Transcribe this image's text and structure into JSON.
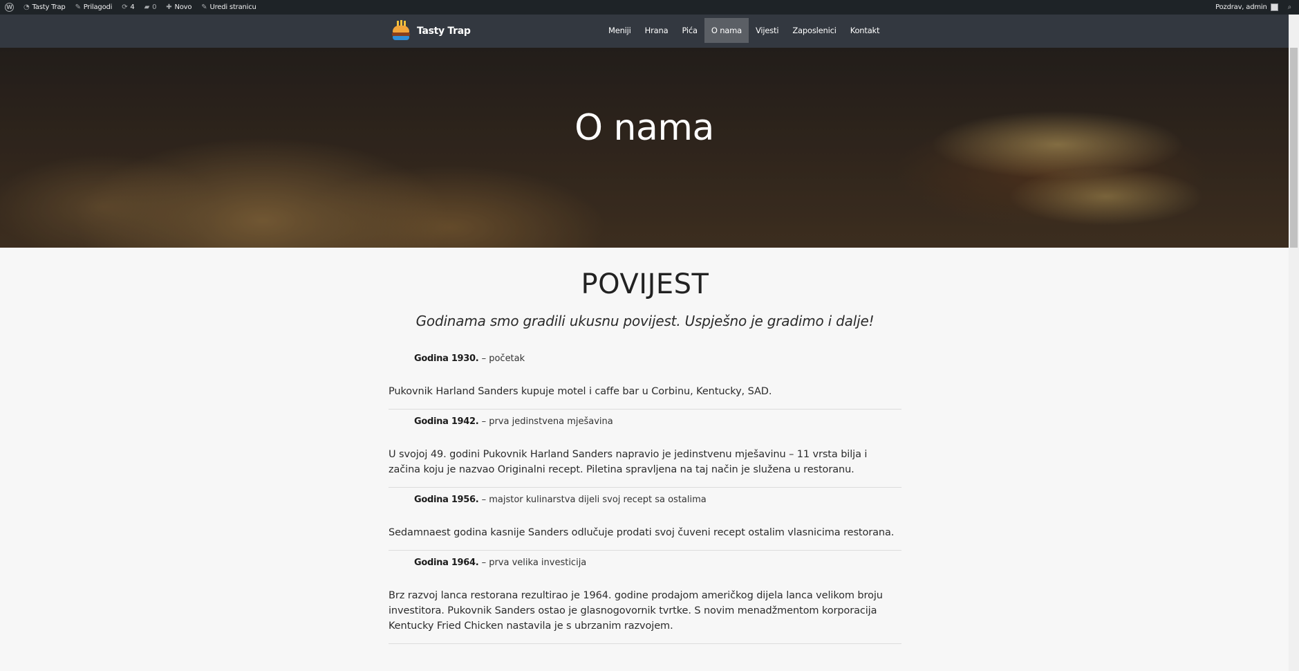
{
  "adminbar": {
    "site_name": "Tasty Trap",
    "customize": "Prilagodi",
    "updates_count": "4",
    "comments_count": "0",
    "new_label": "Novo",
    "edit_label": "Uredi stranicu",
    "greeting": "Pozdrav, admin"
  },
  "header": {
    "brand": "Tasty Trap",
    "nav": [
      "Meniji",
      "Hrana",
      "Pića",
      "O nama",
      "Vijesti",
      "Zaposlenici",
      "Kontakt"
    ],
    "active_nav": "O nama"
  },
  "hero": {
    "title": "O nama"
  },
  "main": {
    "section_title": "POVIJEST",
    "tagline": "Godinama smo gradili ukusnu povijest. Uspješno je gradimo i dalje!",
    "entries": [
      {
        "year": "Godina 1930.",
        "subtitle": "– početak",
        "body": "Pukovnik Harland Sanders kupuje motel i caffe bar u Corbinu, Kentucky, SAD."
      },
      {
        "year": "Godina 1942.",
        "subtitle": "– prva jedinstvena mješavina",
        "body": "U svojoj 49. godini Pukovnik Harland Sanders napravio je jedinstvenu mješavinu – 11 vrsta bilja i začina koju je nazvao Originalni recept. Piletina spravljena na taj način je služena u restoranu."
      },
      {
        "year": "Godina 1956.",
        "subtitle": "– majstor kulinarstva dijeli svoj recept sa ostalima",
        "body": "Sedamnaest godina kasnije Sanders odlučuje prodati svoj čuveni recept ostalim vlasnicima restorana."
      },
      {
        "year": "Godina 1964.",
        "subtitle": "– prva velika investicija",
        "body": "Brz razvoj lanca restorana rezultirao je 1964. godine prodajom američkog dijela lanca velikom broju investitora. Pukovnik Sanders ostao je glasnogovornik tvrtke. S novim menadžmentom korporacija Kentucky Fried Chicken nastavila je s ubrzanim razvojem."
      }
    ]
  }
}
